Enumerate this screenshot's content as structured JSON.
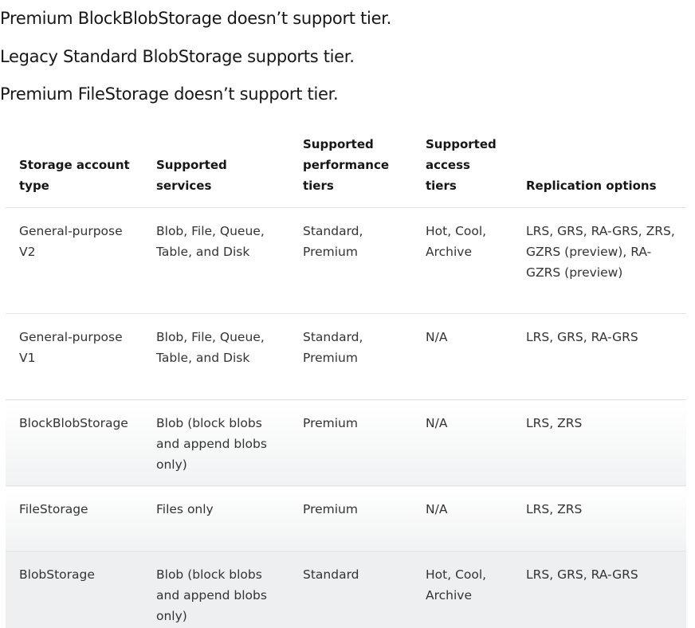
{
  "intro": [
    "Premium BlockBlobStorage doesn’t support tier.",
    "Legacy Standard BlobStorage supports tier.",
    "Premium FileStorage doesn’t support tier."
  ],
  "table": {
    "headers": [
      "Storage account type",
      "Supported services",
      "Supported performance tiers",
      "Supported access tiers",
      "Replication options"
    ],
    "rows": [
      [
        "General-purpose V2",
        "Blob, File, Queue, Table, and Disk",
        "Standard, Premium",
        "Hot, Cool, Archive",
        "LRS, GRS, RA-GRS, ZRS, GZRS (preview), RA-GZRS (preview)"
      ],
      [
        "General-purpose V1",
        "Blob, File, Queue, Table, and Disk",
        "Standard, Premium",
        "N/A",
        "LRS, GRS, RA-GRS"
      ],
      [
        "BlockBlobStorage",
        "Blob (block blobs and append blobs only)",
        "Premium",
        "N/A",
        "LRS, ZRS"
      ],
      [
        "FileStorage",
        "Files only",
        "Premium",
        "N/A",
        "LRS, ZRS"
      ],
      [
        "BlobStorage",
        "Blob (block blobs and append blobs only)",
        "Standard",
        "Hot, Cool, Archive",
        "LRS, GRS, RA-GRS"
      ]
    ]
  }
}
